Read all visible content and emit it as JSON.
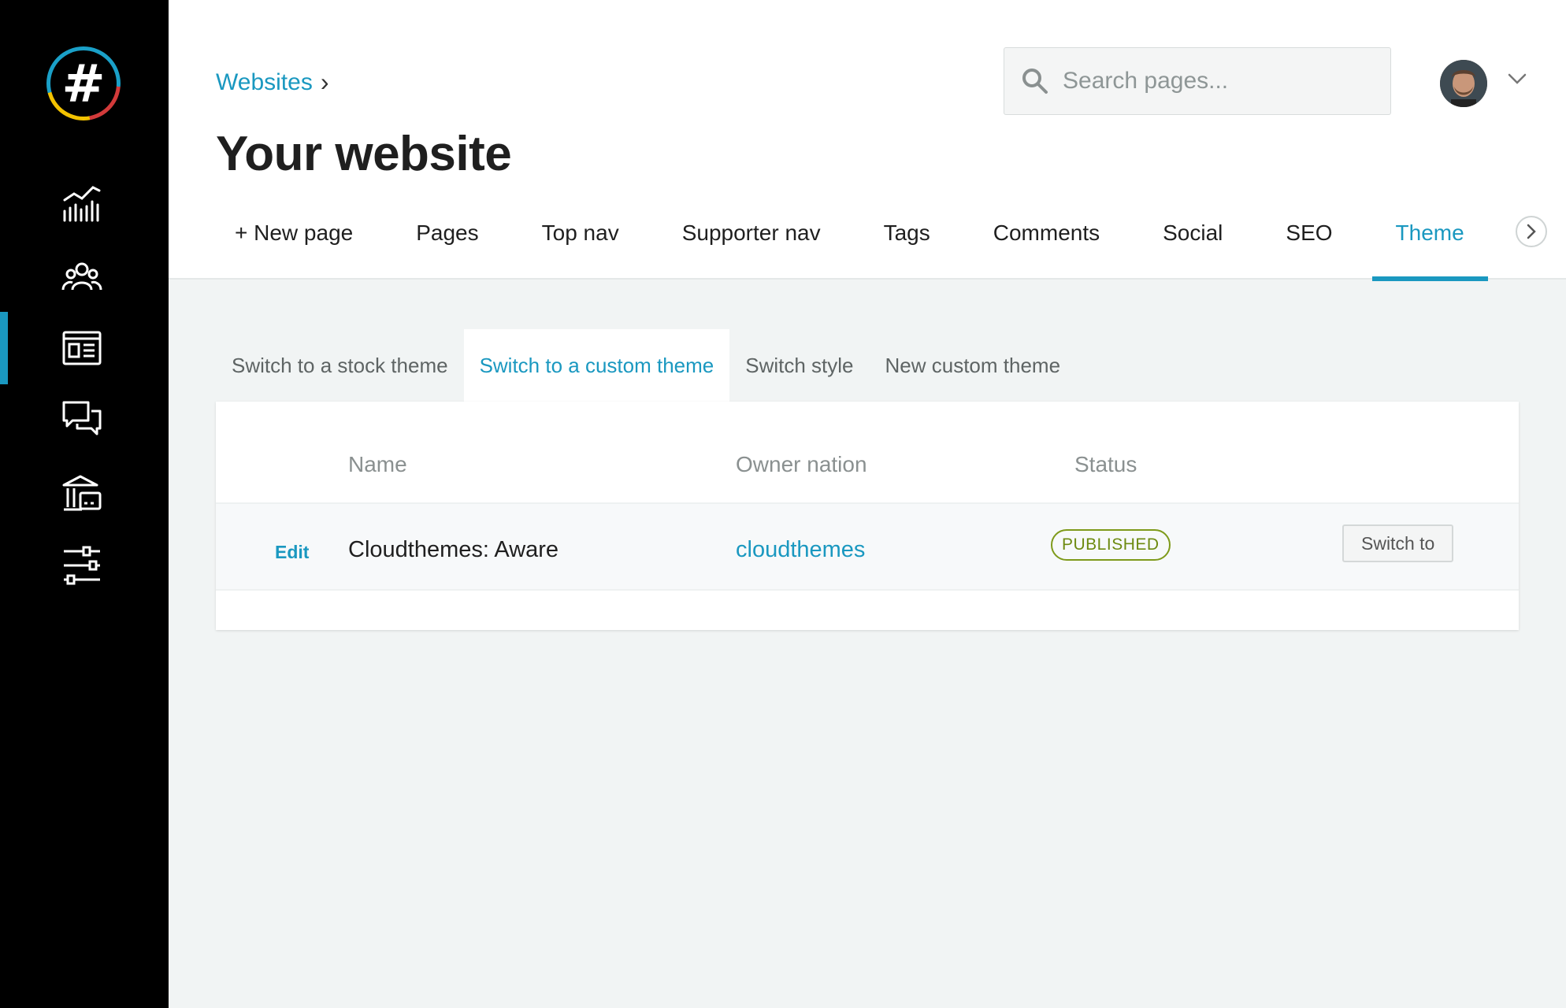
{
  "sidebar": {
    "logo_glyph": "#",
    "icons": [
      "analytics-icon",
      "people-icon",
      "website-icon",
      "comments-icon",
      "finances-icon",
      "settings-icon"
    ],
    "active_index": 2
  },
  "header": {
    "breadcrumb": "Websites",
    "breadcrumb_sep": "›",
    "title": "Your website",
    "search_placeholder": "Search pages..."
  },
  "tabs": [
    {
      "label": "+ New page"
    },
    {
      "label": "Pages"
    },
    {
      "label": "Top nav"
    },
    {
      "label": "Supporter nav"
    },
    {
      "label": "Tags"
    },
    {
      "label": "Comments"
    },
    {
      "label": "Social"
    },
    {
      "label": "SEO"
    },
    {
      "label": "Theme",
      "active": true
    }
  ],
  "subtabs": [
    {
      "label": "Switch to a stock theme"
    },
    {
      "label": "Switch to a custom theme",
      "active": true
    },
    {
      "label": "Switch style"
    },
    {
      "label": "New custom theme"
    }
  ],
  "table": {
    "columns": {
      "name": "Name",
      "owner": "Owner nation",
      "status": "Status"
    },
    "rows": [
      {
        "edit": "Edit",
        "name": "Cloudthemes: Aware",
        "owner": "cloudthemes",
        "status": "PUBLISHED",
        "action": "Switch to"
      }
    ]
  },
  "colors": {
    "accent": "#1a98c0",
    "published": "#7e9a1a",
    "sidebar": "#000000"
  }
}
